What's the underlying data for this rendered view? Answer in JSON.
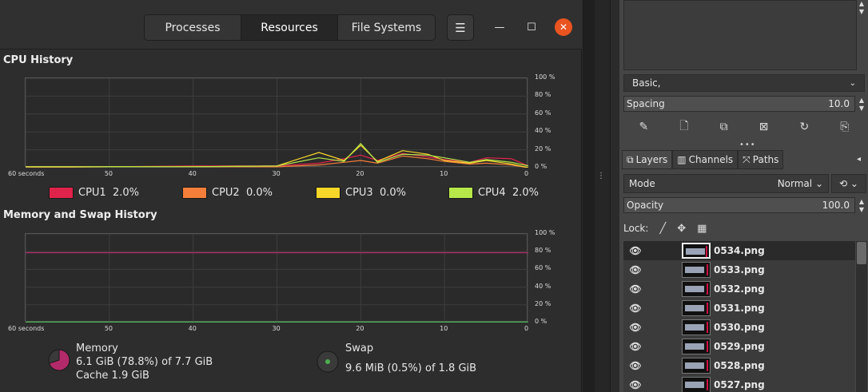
{
  "sysmon": {
    "tabs": [
      {
        "label": "Processes"
      },
      {
        "label": "Resources"
      },
      {
        "label": "File Systems"
      }
    ],
    "menu_icon": "hamburger-icon",
    "cpu": {
      "title": "CPU History",
      "legend": [
        {
          "label": "CPU1",
          "value": "2.0%",
          "color": "#e0234a"
        },
        {
          "label": "CPU2",
          "value": "0.0%",
          "color": "#f57f3a"
        },
        {
          "label": "CPU3",
          "value": "0.0%",
          "color": "#f7d62a"
        },
        {
          "label": "CPU4",
          "value": "2.0%",
          "color": "#b6e84a"
        }
      ]
    },
    "memory": {
      "title": "Memory and Swap History",
      "memory_label": "Memory",
      "memory_used": "6.1 GiB (78.8%) of 7.7 GiB",
      "memory_cache": "Cache 1.9 GiB",
      "swap_label": "Swap",
      "swap_used": "9.6 MiB (0.5%) of 1.8 GiB",
      "memory_color": "#b22a6a",
      "swap_color": "#4caf50"
    },
    "y_ticks": [
      "100 %",
      "80 %",
      "60 %",
      "40 %",
      "20 %",
      "0 %"
    ],
    "x_ticks": [
      "60 seconds",
      "50",
      "40",
      "30",
      "20",
      "10",
      "0"
    ]
  },
  "chart_data": [
    {
      "type": "line",
      "title": "CPU History",
      "x": [
        60,
        50,
        40,
        30,
        25,
        22,
        20,
        18,
        15,
        12,
        10,
        7,
        5,
        2,
        0
      ],
      "series": [
        {
          "name": "CPU1",
          "values": [
            1,
            1,
            2,
            2,
            5,
            10,
            14,
            8,
            16,
            12,
            9,
            6,
            11,
            10,
            2
          ]
        },
        {
          "name": "CPU2",
          "values": [
            0,
            1,
            1,
            1,
            3,
            6,
            8,
            5,
            13,
            10,
            7,
            4,
            5,
            3,
            0
          ]
        },
        {
          "name": "CPU3",
          "values": [
            1,
            1,
            1,
            2,
            17,
            8,
            25,
            7,
            19,
            15,
            8,
            5,
            8,
            4,
            0
          ]
        },
        {
          "name": "CPU4",
          "values": [
            1,
            1,
            1,
            2,
            11,
            7,
            27,
            6,
            15,
            14,
            11,
            6,
            9,
            6,
            2
          ]
        }
      ],
      "ylim": [
        0,
        100
      ],
      "xlim": [
        60,
        0
      ],
      "grid": true
    },
    {
      "type": "line",
      "title": "Memory and Swap History",
      "x": [
        60,
        0
      ],
      "series": [
        {
          "name": "Memory",
          "values": [
            78.8,
            78.8
          ]
        },
        {
          "name": "Swap",
          "values": [
            0.5,
            0.5
          ]
        }
      ],
      "ylim": [
        0,
        100
      ],
      "xlim": [
        60,
        0
      ],
      "grid": true
    }
  ],
  "gimp": {
    "brush_name": "Basic,",
    "spacing_label": "Spacing",
    "spacing_value": "10.0",
    "tabs": [
      {
        "label": "Layers",
        "icon": "layers-icon"
      },
      {
        "label": "Channels",
        "icon": "channels-icon"
      },
      {
        "label": "Paths",
        "icon": "paths-icon"
      }
    ],
    "mode_label": "Mode",
    "mode_value": "Normal",
    "opacity_label": "Opacity",
    "opacity_value": "100.0",
    "lock_label": "Lock:",
    "layers": [
      {
        "name": "0534.png"
      },
      {
        "name": "0533.png"
      },
      {
        "name": "0532.png"
      },
      {
        "name": "0531.png"
      },
      {
        "name": "0530.png"
      },
      {
        "name": "0529.png"
      },
      {
        "name": "0528.png"
      },
      {
        "name": "0527.png"
      }
    ]
  }
}
